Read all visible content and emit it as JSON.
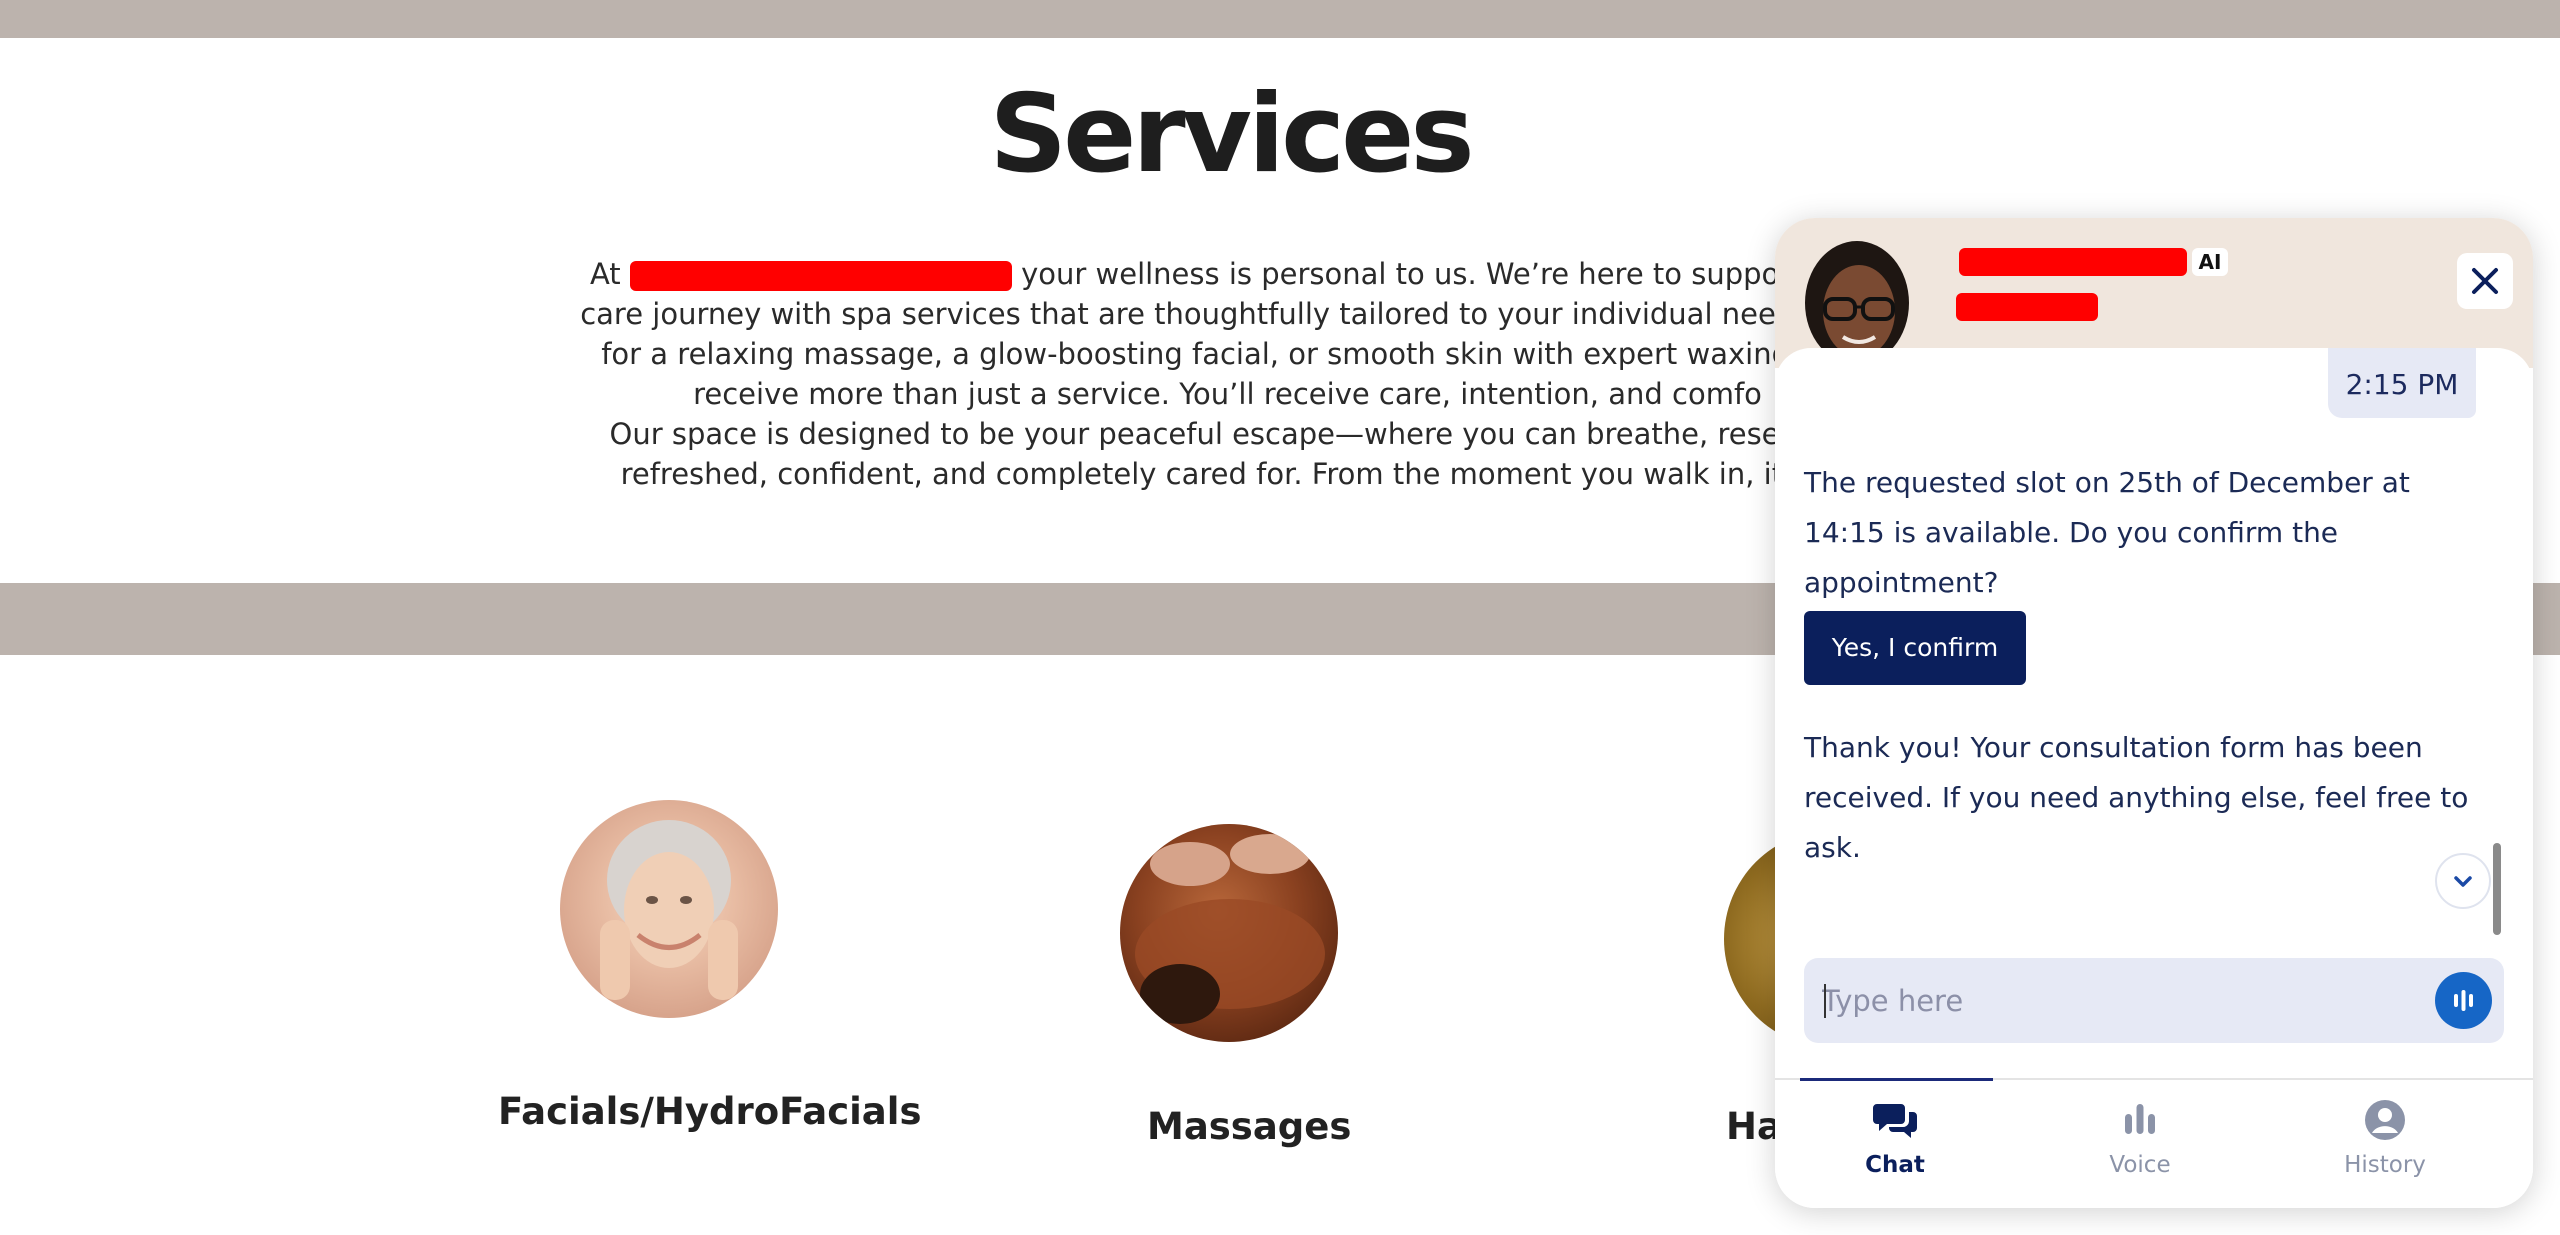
{
  "page": {
    "title": "Services",
    "intro_lines": [
      [
        "At",
        "your wellness is personal to us. We’re here to support you"
      ],
      "care journey with spa services that are thoughtfully tailored to your individual needs. Wh",
      "for a relaxing massage, a glow-boosting facial, or smooth skin with expert waxing and",
      "receive more than just a service. You’ll receive care, intention, and comfo",
      "Our space is designed to be your peaceful escape—where you can breathe, reset, an",
      "refreshed, confident, and completely cared for. From the moment you walk in, it’s a"
    ],
    "intro_line1_before": "At",
    "intro_line1_after": "your wellness is personal to us. We’re here to support you",
    "intro_line2": "care journey with spa services that are thoughtfully tailored to your individual needs. Wh",
    "intro_line3": "for a relaxing massage, a glow-boosting facial, or smooth skin with expert waxing and",
    "intro_line4": "receive more than just a service. You’ll receive care, intention, and comfo",
    "intro_line5": "Our space is designed to be your peaceful escape—where you can breathe, reset, an",
    "intro_line6": "refreshed, confident, and completely cared for. From the moment you walk in, it’s a",
    "services": [
      {
        "label": "Facials/HydroFacials"
      },
      {
        "label": "Massages"
      },
      {
        "label": "Ha"
      }
    ]
  },
  "chat": {
    "ai_badge": "AI",
    "timestamp": "2:15 PM",
    "messages": [
      "The requested slot on 25th of December at 14:15 is available. Do you confirm the appointment?",
      "Thank you! Your consultation form has been received. If you need anything else, feel free to ask."
    ],
    "confirm_button": "Yes, I confirm",
    "input_placeholder": "Type here",
    "nav": [
      {
        "label": "Chat",
        "icon": "chat-icon",
        "active": true
      },
      {
        "label": "Voice",
        "icon": "voice-bars-icon",
        "active": false
      },
      {
        "label": "History",
        "icon": "user-history-icon",
        "active": false
      }
    ]
  },
  "colors": {
    "band": "#bcb3ad",
    "chat_header": "#f0e6dd",
    "primary": "#0b1f5c",
    "mic": "#1666c6",
    "redaction": "#ff0000"
  }
}
